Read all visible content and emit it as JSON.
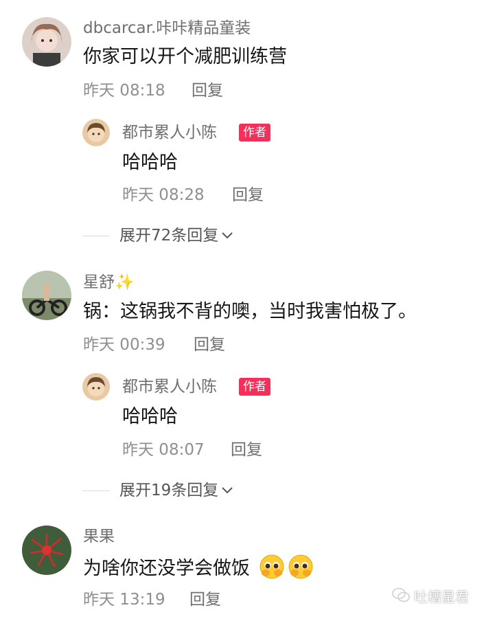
{
  "comments": [
    {
      "username": "dbcarcar.咔咔精品童装",
      "text": "你家可以开个减肥训练营",
      "time": "昨天 08:18",
      "reply_label": "回复",
      "author_reply": {
        "username": "都市累人小陈",
        "badge": "作者",
        "text": "哈哈哈",
        "time": "昨天 08:28",
        "reply_label": "回复"
      },
      "expand_label": "展开72条回复"
    },
    {
      "username": "星舒✨",
      "text": "锅：这锅我不背的噢，当时我害怕极了。",
      "time": "昨天 00:39",
      "reply_label": "回复",
      "author_reply": {
        "username": "都市累人小陈",
        "badge": "作者",
        "text": "哈哈哈",
        "time": "昨天 08:07",
        "reply_label": "回复"
      },
      "expand_label": "展开19条回复"
    },
    {
      "username": "果果",
      "text": "为啥你还没学会做饭",
      "emojis": [
        "pleading-face-emoji",
        "pleading-face-emoji"
      ],
      "time": "昨天 13:19",
      "reply_label": "回复"
    }
  ],
  "watermark": {
    "text": "吐槽星君",
    "icon": "wechat-icon"
  },
  "colors": {
    "badge": "#f2305b",
    "username": "#6e6e73",
    "time": "#8e8e93",
    "text": "#161616"
  }
}
